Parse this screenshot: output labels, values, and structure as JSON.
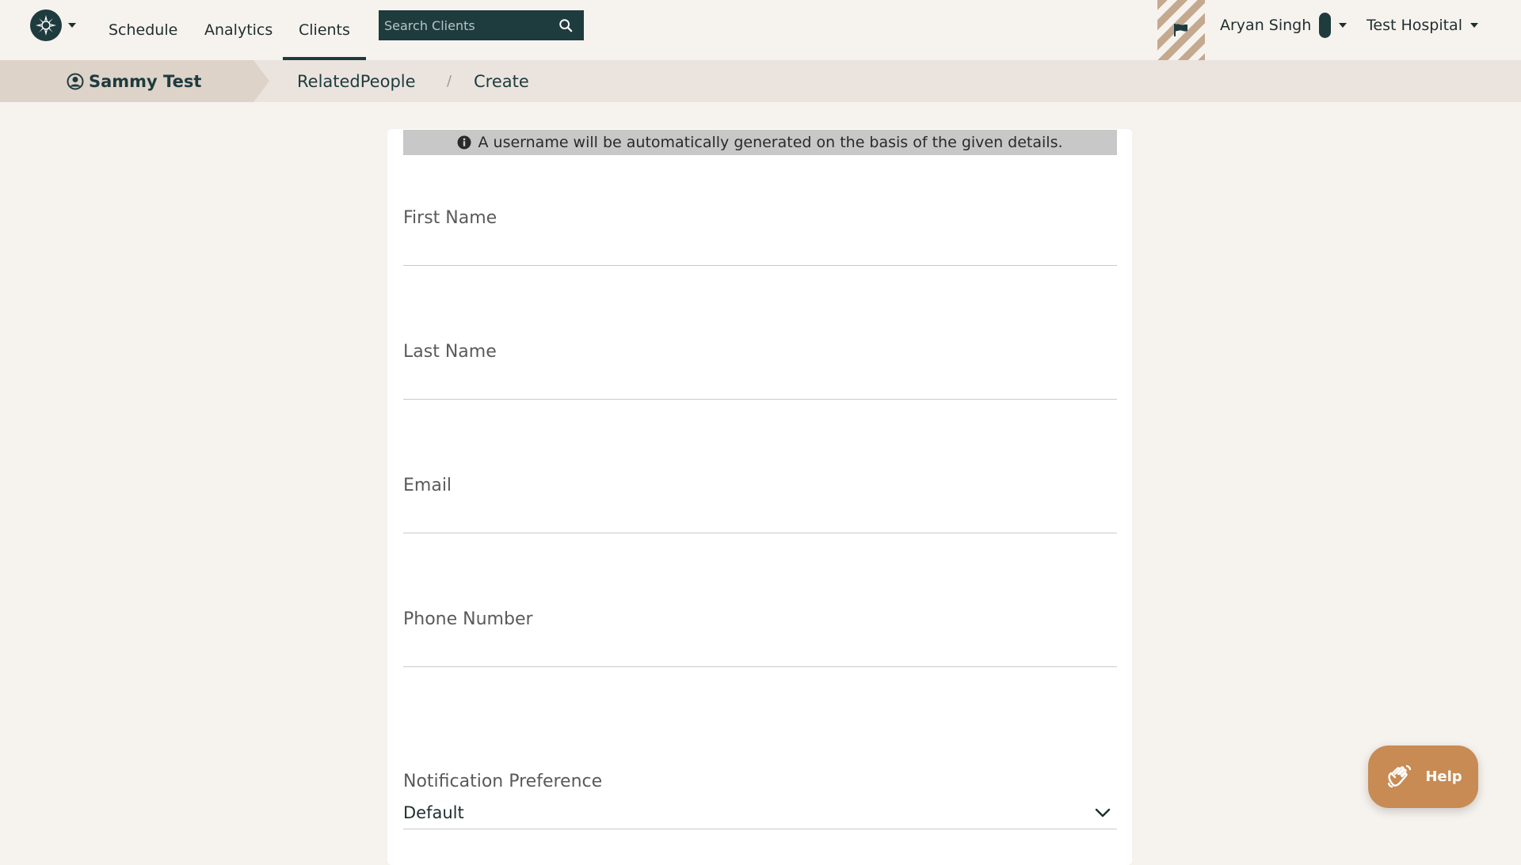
{
  "nav": {
    "links": [
      "Schedule",
      "Analytics",
      "Clients"
    ],
    "active": "Clients",
    "search_placeholder": "Search Clients",
    "user_name": "Aryan Singh",
    "org_name": "Test Hospital"
  },
  "breadcrumb": {
    "client": "Sammy Test",
    "section": "RelatedPeople",
    "separator": "/",
    "page": "Create"
  },
  "form": {
    "info_message": "A username will be automatically generated on the basis of the given details.",
    "first_name_label": "First Name",
    "last_name_label": "Last Name",
    "email_label": "Email",
    "phone_label": "Phone Number",
    "notification_label": "Notification Preference",
    "notification_value": "Default"
  },
  "help": {
    "label": "Help"
  },
  "colors": {
    "primary": "#1e3b3e",
    "background": "#f6f2ee",
    "breadcrumb_bg": "#ebe4de",
    "help_accent": "#c88b54"
  }
}
